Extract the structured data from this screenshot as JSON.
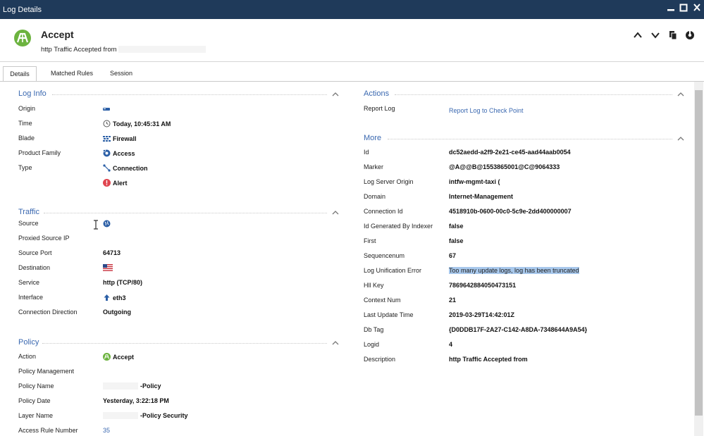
{
  "window": {
    "title": "Log Details"
  },
  "header": {
    "title": "Accept",
    "subtitle": "http Traffic Accepted from"
  },
  "tabs": [
    {
      "label": "Details",
      "active": true
    },
    {
      "label": "Matched Rules",
      "active": false
    },
    {
      "label": "Session",
      "active": false
    }
  ],
  "log_info": {
    "heading": "Log Info",
    "rows": [
      {
        "label": "Origin",
        "value": "",
        "icon": "gateway-icon"
      },
      {
        "label": "Time",
        "value": "Today, 10:45:31 AM",
        "icon": "clock-icon"
      },
      {
        "label": "Blade",
        "value": "Firewall",
        "icon": "firewall-icon"
      },
      {
        "label": "Product Family",
        "value": "Access",
        "icon": "access-icon"
      },
      {
        "label": "Type",
        "value": "Connection",
        "icon": "connection-icon"
      },
      {
        "label": "",
        "value": "Alert",
        "icon": "alert-icon"
      }
    ]
  },
  "traffic": {
    "heading": "Traffic",
    "rows": [
      {
        "label": "Source",
        "value": "",
        "icon": "globe-icon"
      },
      {
        "label": "Proxied Source IP",
        "value": ""
      },
      {
        "label": "Source Port",
        "value": "64713"
      },
      {
        "label": "Destination",
        "value": "",
        "icon": "us-flag-icon"
      },
      {
        "label": "Service",
        "value": "http (TCP/80)"
      },
      {
        "label": "Interface",
        "value": "eth3",
        "icon": "arrow-up-icon"
      },
      {
        "label": "Connection Direction",
        "value": "Outgoing"
      }
    ]
  },
  "policy": {
    "heading": "Policy",
    "rows": [
      {
        "label": "Action",
        "value": "Accept",
        "icon": "accept-icon"
      },
      {
        "label": "Policy Management",
        "value": ""
      },
      {
        "label": "Policy Name",
        "value": "-Policy"
      },
      {
        "label": "Policy Date",
        "value": "Yesterday, 3:22:18 PM"
      },
      {
        "label": "Layer Name",
        "value": "-Policy Security"
      },
      {
        "label": "Access Rule Number",
        "value": "35"
      }
    ]
  },
  "actions": {
    "heading": "Actions",
    "rows": [
      {
        "label": "Report Log",
        "value": "Report Log to Check Point"
      }
    ]
  },
  "more": {
    "heading": "More",
    "rows": [
      {
        "label": "Id",
        "value": "dc52aedd-a2f9-2e21-ce45-aad44aab0054"
      },
      {
        "label": "Marker",
        "value": "@A@@B@1553865001@C@9064333"
      },
      {
        "label": "Log Server Origin",
        "value": "intfw-mgmt-taxi ("
      },
      {
        "label": "Domain",
        "value": "Internet-Management"
      },
      {
        "label": "Connection Id",
        "value": "4518910b-0600-00c0-5c9e-2dd400000007"
      },
      {
        "label": "Id Generated By Indexer",
        "value": "false"
      },
      {
        "label": "First",
        "value": "false"
      },
      {
        "label": "Sequencenum",
        "value": "67"
      },
      {
        "label": "Log Unification Error",
        "value": "Too many update logs, log has been truncated"
      },
      {
        "label": "Hll Key",
        "value": "7869642884050473151"
      },
      {
        "label": "Context Num",
        "value": "21"
      },
      {
        "label": "Last Update Time",
        "value": "2019-03-29T14:42:01Z"
      },
      {
        "label": "Db Tag",
        "value": "{D0DDB17F-2A27-C142-A8DA-7348644A9A54}"
      },
      {
        "label": "Logid",
        "value": "4"
      },
      {
        "label": "Description",
        "value": "http Traffic Accepted from"
      }
    ]
  },
  "colors": {
    "titlebar": "#1f3a5a",
    "section_heading": "#3a68b0",
    "accept_green": "#6cb33f",
    "alert_red": "#e0454f",
    "selection": "#a8c8ec"
  }
}
